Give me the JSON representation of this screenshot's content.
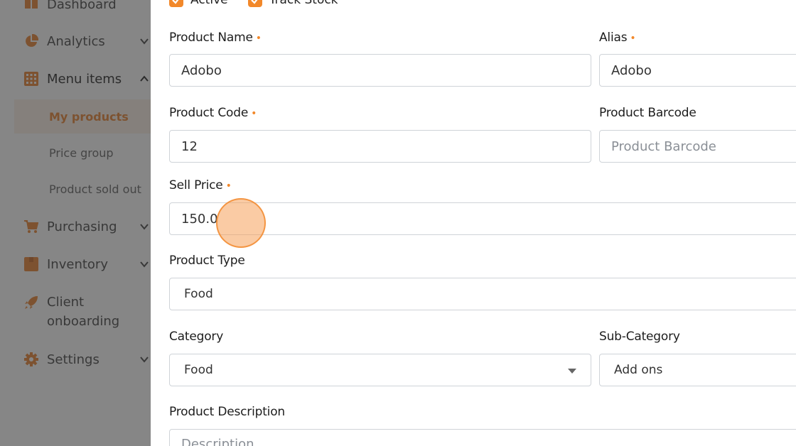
{
  "sidebar": {
    "items": [
      {
        "label": "Dashboard",
        "icon": "dashboard-icon"
      },
      {
        "label": "Analytics",
        "icon": "pie-chart-icon"
      },
      {
        "label": "Menu items",
        "icon": "grid-icon"
      },
      {
        "label": "Purchasing",
        "icon": "cart-icon"
      },
      {
        "label": "Inventory",
        "icon": "box-icon"
      },
      {
        "label": "Client",
        "label2": "onboarding",
        "icon": "rocket-icon"
      },
      {
        "label": "Settings",
        "icon": "gear-icon"
      }
    ],
    "sub_items": [
      {
        "label": "My products",
        "active": true
      },
      {
        "label": "Price group"
      },
      {
        "label": "Product sold out"
      }
    ]
  },
  "form": {
    "checks": {
      "active": "Active",
      "track_stock": "Track Stock"
    },
    "product_name": {
      "label": "Product Name",
      "value": "Adobo"
    },
    "alias": {
      "label": "Alias",
      "value": "Adobo"
    },
    "product_code": {
      "label": "Product Code",
      "value": "12"
    },
    "product_barcode": {
      "label": "Product Barcode",
      "placeholder": "Product Barcode"
    },
    "sell_price": {
      "label": "Sell Price",
      "value": "150.0"
    },
    "product_type": {
      "label": "Product Type",
      "value": "Food"
    },
    "category": {
      "label": "Category",
      "value": "Food"
    },
    "sub_category": {
      "label": "Sub-Category",
      "value": "Add ons"
    },
    "description": {
      "label": "Product Description",
      "placeholder": "Description"
    },
    "required_mark": "•"
  },
  "colors": {
    "accent": "#f2882a",
    "overlay": "#3c3c3c"
  }
}
